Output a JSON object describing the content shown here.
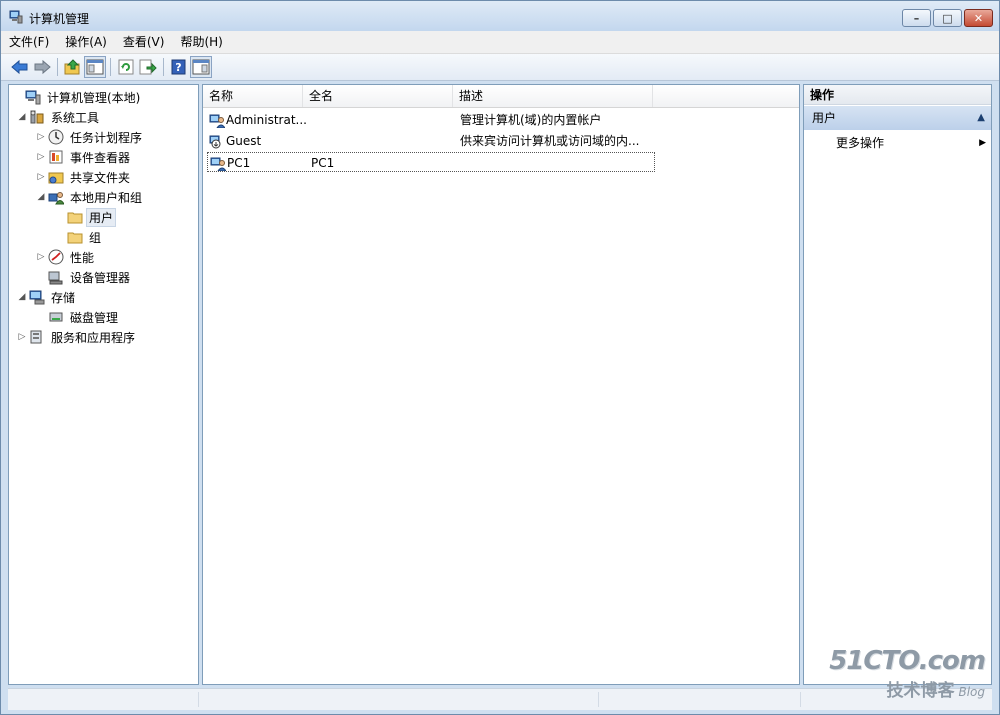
{
  "window": {
    "title": "计算机管理",
    "buttons": {
      "minimize": "–",
      "restore": "□",
      "close": "✕"
    }
  },
  "menu": [
    "文件(F)",
    "操作(A)",
    "查看(V)",
    "帮助(H)"
  ],
  "toolbar": [
    "back-arrow-icon",
    "forward-arrow-icon",
    "up-folder-icon",
    "show-hide-tree-icon",
    "refresh-icon",
    "export-list-icon",
    "help-icon",
    "show-hide-action-pane-icon"
  ],
  "tree": [
    {
      "label": "计算机管理(本地)",
      "level": 0,
      "expander": "",
      "icon": "computer-management-icon"
    },
    {
      "label": "系统工具",
      "level": 1,
      "expander": "◢",
      "icon": "system-tools-icon"
    },
    {
      "label": "任务计划程序",
      "level": 2,
      "expander": "▷",
      "icon": "clock-icon"
    },
    {
      "label": "事件查看器",
      "level": 2,
      "expander": "▷",
      "icon": "event-viewer-icon"
    },
    {
      "label": "共享文件夹",
      "level": 2,
      "expander": "▷",
      "icon": "shared-folder-icon"
    },
    {
      "label": "本地用户和组",
      "level": 2,
      "expander": "◢",
      "icon": "users-group-icon"
    },
    {
      "label": "用户",
      "level": 3,
      "expander": "",
      "icon": "folder-icon",
      "selected": true
    },
    {
      "label": "组",
      "level": 3,
      "expander": "",
      "icon": "folder-icon"
    },
    {
      "label": "性能",
      "level": 2,
      "expander": "▷",
      "icon": "performance-icon"
    },
    {
      "label": "设备管理器",
      "level": 2,
      "expander": "",
      "icon": "device-manager-icon"
    },
    {
      "label": "存储",
      "level": 1,
      "expander": "◢",
      "icon": "storage-icon"
    },
    {
      "label": "磁盘管理",
      "level": 2,
      "expander": "",
      "icon": "disk-management-icon"
    },
    {
      "label": "服务和应用程序",
      "level": 1,
      "expander": "▷",
      "icon": "services-icon"
    }
  ],
  "list": {
    "columns": [
      "名称",
      "全名",
      "描述"
    ],
    "rows": [
      {
        "name": "Administrat...",
        "full_name": "",
        "description": "管理计算机(域)的内置帐户",
        "icon": "user-icon"
      },
      {
        "name": "Guest",
        "full_name": "",
        "description": "供来宾访问计算机或访问域的内...",
        "icon": "disabled-user-icon"
      },
      {
        "name": "PC1",
        "full_name": "PC1",
        "description": "",
        "icon": "user-icon",
        "focused": true
      }
    ]
  },
  "actions": {
    "header": "操作",
    "group": "用户",
    "group_caret": "▲",
    "items": [
      {
        "label": "更多操作",
        "arrow": "▶"
      }
    ]
  },
  "watermark": {
    "line1": "51CTO.com",
    "line2": "技术博客",
    "line3": "Blog"
  }
}
